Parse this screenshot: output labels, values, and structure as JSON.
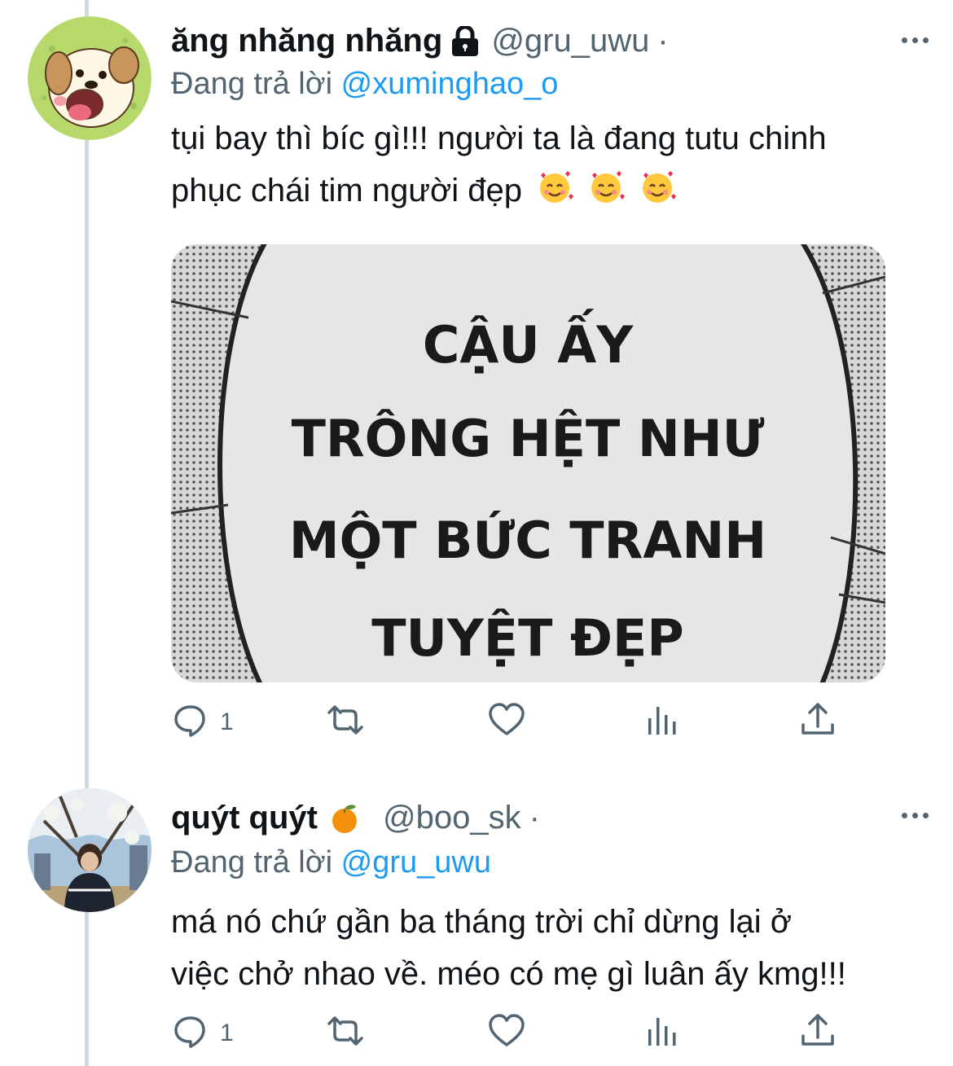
{
  "tweets": [
    {
      "display_name": "ăng nhăng nhăng",
      "handle": "@gru_uwu",
      "separator": "·",
      "replying_prefix": "Đang trả lời",
      "replying_to": "@xuminghao_o",
      "text_line1": "tụi bay thì bíc gì!!! người ta là đang tutu chinh",
      "text_line2": "phục chái tim người đẹp",
      "emojis": [
        "smiling-face-with-hearts",
        "smiling-face-with-hearts",
        "smiling-face-with-hearts"
      ],
      "image_text": [
        "CẬU ẤY",
        "TRÔNG HỆT NHƯ",
        "MỘT BỨC TRANH",
        "TUYỆT ĐẸP"
      ],
      "reply_count": "1",
      "icons": [
        "reply-icon",
        "retweet-icon",
        "like-icon",
        "analytics-icon",
        "share-icon"
      ]
    },
    {
      "display_name": "quýt quýt",
      "handle": "@boo_sk",
      "separator": "·",
      "replying_prefix": "Đang trả lời",
      "replying_to": "@gru_uwu",
      "text_line1": "má nó chứ gần ba tháng trời chỉ dừng lại ở",
      "text_line2": "việc chở nhao về. méo có mẹ gì luân ấy kmg!!!",
      "reply_count": "1",
      "icons": [
        "reply-icon",
        "retweet-icon",
        "like-icon",
        "analytics-icon",
        "share-icon"
      ]
    }
  ],
  "colors": {
    "accent": "#1d9bf0",
    "secondary_text": "#536471",
    "thread_line": "#cfd9de"
  }
}
